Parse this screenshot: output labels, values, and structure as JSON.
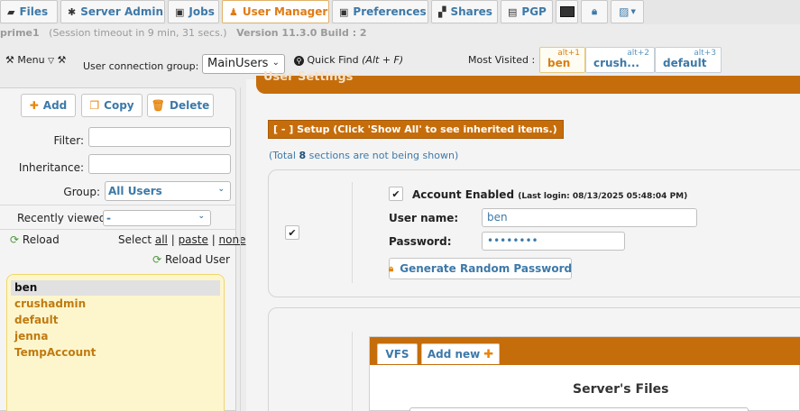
{
  "tabs": [
    {
      "label": "Files",
      "icon": "folder-icon"
    },
    {
      "label": "Server Admin",
      "icon": "gear-icon"
    },
    {
      "label": "Jobs",
      "icon": "jobs-icon"
    },
    {
      "label": "User Manager",
      "icon": "user-icon",
      "active": true
    },
    {
      "label": "Preferences",
      "icon": "preferences-icon"
    },
    {
      "label": "Shares",
      "icon": "shares-icon"
    },
    {
      "label": "PGP",
      "icon": "pgp-icon"
    }
  ],
  "session": {
    "server": "prime1",
    "timeout": "(Session timeout in 9 min, 31 secs.)",
    "version": "Version 11.3.0 Build : 2"
  },
  "toolbar": {
    "menu_label": "Menu",
    "group_label": "User connection group:",
    "group_value": "MainUsers",
    "quick_find_label": "Quick Find",
    "quick_find_shortcut": "(Alt + F)",
    "most_visited_label": "Most Visited :",
    "most_visited": [
      {
        "label": "ben",
        "shortcut": "alt+1"
      },
      {
        "label": "crush...",
        "shortcut": "alt+2"
      },
      {
        "label": "default",
        "shortcut": "alt+3"
      }
    ]
  },
  "left": {
    "add_label": "Add",
    "copy_label": "Copy",
    "delete_label": "Delete",
    "filter_label": "Filter:",
    "inheritance_label": "Inheritance:",
    "group_label": "Group:",
    "group_value": "All Users",
    "recent_label": "Recently viewed:",
    "recent_value": "-",
    "reload_label": "Reload",
    "select_label": "Select",
    "select_all": "all",
    "select_paste": "paste",
    "select_none": "none",
    "reload_user_label": "Reload User",
    "users": [
      "ben",
      "crushadmin",
      "default",
      "jenna",
      "TempAccount"
    ],
    "selected_user": "ben"
  },
  "main": {
    "section_title": "User Settings",
    "setup_tab": "[ - ] Setup (Click 'Show All' to see inherited items.)",
    "total_prefix": "(Total",
    "total_count": "8",
    "total_suffix": "sections are not being shown)",
    "account_enabled_label": "Account Enabled",
    "last_login": "(Last login: 08/13/2025 05:48:04 PM)",
    "username_label": "User name:",
    "username_value": "ben",
    "password_label": "Password:",
    "password_value": "••••••••",
    "generate_password_label": "Generate Random Password",
    "vfs_tab": "VFS",
    "add_new_tab": "Add new",
    "server_files_title": "Server's Files"
  },
  "colors": {
    "accent": "#c66d0b",
    "link_blue": "#3d79a8",
    "user_list_bg": "#fdf6cd"
  }
}
